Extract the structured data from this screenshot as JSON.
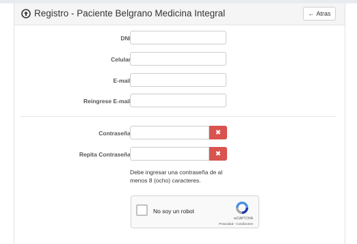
{
  "header": {
    "title": "Registro - Paciente Belgrano Medicina Integral",
    "back_label": "Atras"
  },
  "form": {
    "dni_label": "DNI",
    "dni_value": "",
    "celular_label": "Celular",
    "celular_value": "",
    "email_label": "E-mail",
    "email_value": "",
    "email_confirm_label": "Reingrese E-mail",
    "email_confirm_value": "",
    "password_label": "Contraseña",
    "password_value": "",
    "password_confirm_label": "Repita Contraseña",
    "password_confirm_value": "",
    "clear_symbol": "✖",
    "help_text": "Debe ingresar una contraseña de al menos 8 (ocho) caracteres."
  },
  "recaptcha": {
    "label": "No soy un robot",
    "brand": "reCAPTCHA",
    "links": "Privacidad - Condiciones"
  },
  "colors": {
    "danger": "#d9534f",
    "heading_bg": "#f5f5f5"
  }
}
